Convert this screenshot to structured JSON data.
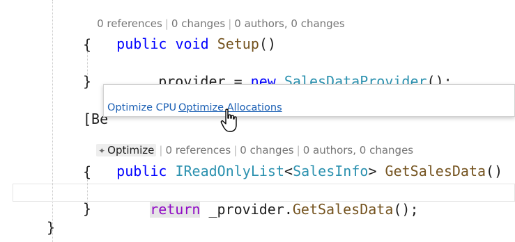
{
  "editor": {
    "lens_top": {
      "references": "0 references",
      "changes": "0 changes",
      "authors": "0 authors, 0 changes"
    },
    "setup_line": {
      "public": "public",
      "void": "void",
      "name": "Setup",
      "parens": "()"
    },
    "open_brace_1": "{",
    "provider_line": {
      "field": "_provider",
      "eq": " = ",
      "new": "new",
      "type": "SalesDataProvider",
      "tail": "();"
    },
    "close_brace_1": "}",
    "attribute_line": "[Be",
    "lens_bottom": {
      "optimize": "Optimize",
      "references": "0 references",
      "changes": "0 changes",
      "authors": "0 authors, 0 changes"
    },
    "getsales_line": {
      "public": "public",
      "iface": "IReadOnlyList",
      "lt": "<",
      "gen": "SalesInfo",
      "gt": ">",
      "name": "GetSalesData",
      "parens": "()"
    },
    "open_brace_2": "{",
    "return_line": {
      "return": "return",
      "field": "_provider",
      "dot": ".",
      "method": "GetSalesData",
      "tail": "();"
    },
    "close_brace_2": "}",
    "close_brace_class": "}"
  },
  "popup": {
    "items": [
      "Optimize CPU",
      "Optimize Allocations"
    ]
  },
  "icons": {
    "optimize": "sparkle-icon",
    "pointer": "hand-pointer-icon"
  },
  "colors": {
    "keyword": "#0000ff",
    "control_keyword": "#8f08c4",
    "type": "#2b91af",
    "method": "#74531f",
    "link": "#1a5fb4",
    "lens_text": "#767676"
  }
}
